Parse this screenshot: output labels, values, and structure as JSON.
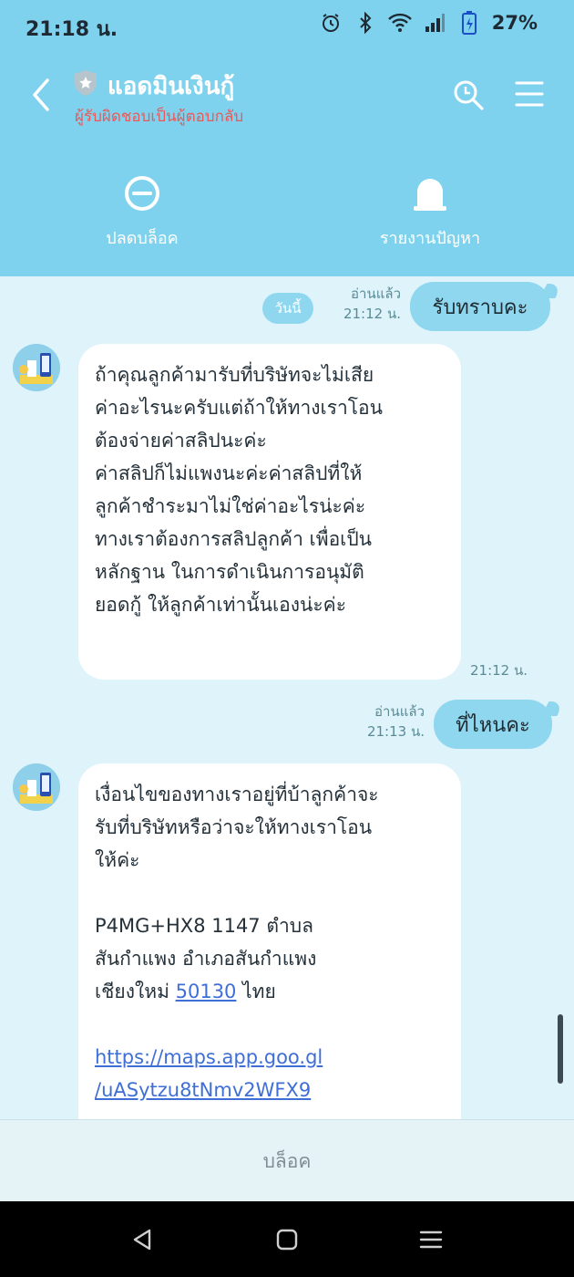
{
  "status_bar": {
    "time": "21:18 น.",
    "battery": "27%"
  },
  "header": {
    "title": "แอดมินเงินกู้",
    "subtitle": "ผู้รับผิดชอบเป็นผู้ตอบกลับ",
    "actions": [
      {
        "label": "ปลดบล็อค",
        "icon": "unblock-icon"
      },
      {
        "label": "รายงานปัญหา",
        "icon": "bell-icon"
      }
    ]
  },
  "chat": {
    "date_pill": "วันนี้",
    "messages": [
      {
        "direction": "out",
        "read": "อ่านแล้ว",
        "time": "21:12 น.",
        "text": "รับทราบคะ"
      },
      {
        "direction": "in",
        "time": "21:12 น.",
        "lines": [
          " ถ้าคุณลูกค้ามารับที่บริษัทจะไม่เสีย",
          "ค่าอะไรนะครับแต่ถ้าให้ทางเราโอน",
          "ต้องจ่ายค่าสลิปนะค่ะ",
          "ค่าสลิปก็ไม่แพงนะค่ะค่าสลิปที่ให้",
          "ลูกค้าชำระมาไม่ใช่ค่าอะไรน่ะค่ะ",
          "ทางเราต้องการสลิปลูกค้า เพื่อเป็น",
          "หลักฐาน  ในการดำเนินการอนุมัติ",
          "ยอดกู้ ให้ลูกค้าเท่านั้นเองน่ะค่ะ"
        ]
      },
      {
        "direction": "out",
        "read": "อ่านแล้ว",
        "time": "21:13 น.",
        "text": "ที่ไหนคะ"
      },
      {
        "direction": "in",
        "lines": [
          "เงื่อนไขของทางเราอยู่ที่บ้าลูกค้าจะ",
          "รับที่บริษัทหรือว่าจะให้ทางเราโอน",
          "ให้ค่ะ"
        ],
        "address_line1": "P4MG+HX8 1147 ตำบล",
        "address_line2": "สันกำแพง อำเภอสันกำแพง",
        "address_line3_prefix": "เชียงใหม่ ",
        "postcode": "50130",
        "address_line3_suffix": " ไทย",
        "link_line1": "https://maps.app.goo.gl",
        "link_line2": "/uASytzu8tNmv2WFX9"
      }
    ]
  },
  "footer": {
    "block_label": "บล็อค"
  },
  "colors": {
    "header": "#7fd2ee",
    "chat_bg": "#dff3fb",
    "bubble_out": "#8fd7ef",
    "subtitle": "#e85a5a",
    "link": "#3f6fd6"
  }
}
